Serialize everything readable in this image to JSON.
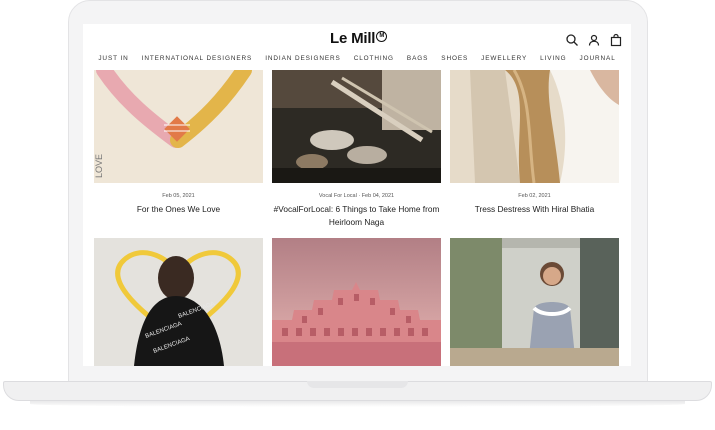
{
  "brand": {
    "name": "Le Mill",
    "badge": "M"
  },
  "nav": {
    "items": [
      "JUST IN",
      "INTERNATIONAL DESIGNERS",
      "INDIAN DESIGNERS",
      "CLOTHING",
      "BAGS",
      "SHOES",
      "JEWELLERY",
      "LIVING",
      "JOURNAL"
    ]
  },
  "header_icons": [
    "search-icon",
    "account-icon",
    "bag-icon"
  ],
  "posts": [
    {
      "meta": "Feb 05, 2021",
      "title": "For the Ones We Love",
      "image_text": "LOVE"
    },
    {
      "meta": "Vocal For Local · Feb 04, 2021",
      "title": "#VocalForLocal: 6 Things to Take Home from Heirloom Naga"
    },
    {
      "meta": "Feb 02, 2021",
      "title": "Tress Destress With Hiral Bhatia"
    },
    {
      "meta": "",
      "title": ""
    },
    {
      "meta": "",
      "title": ""
    },
    {
      "meta": "",
      "title": ""
    }
  ]
}
